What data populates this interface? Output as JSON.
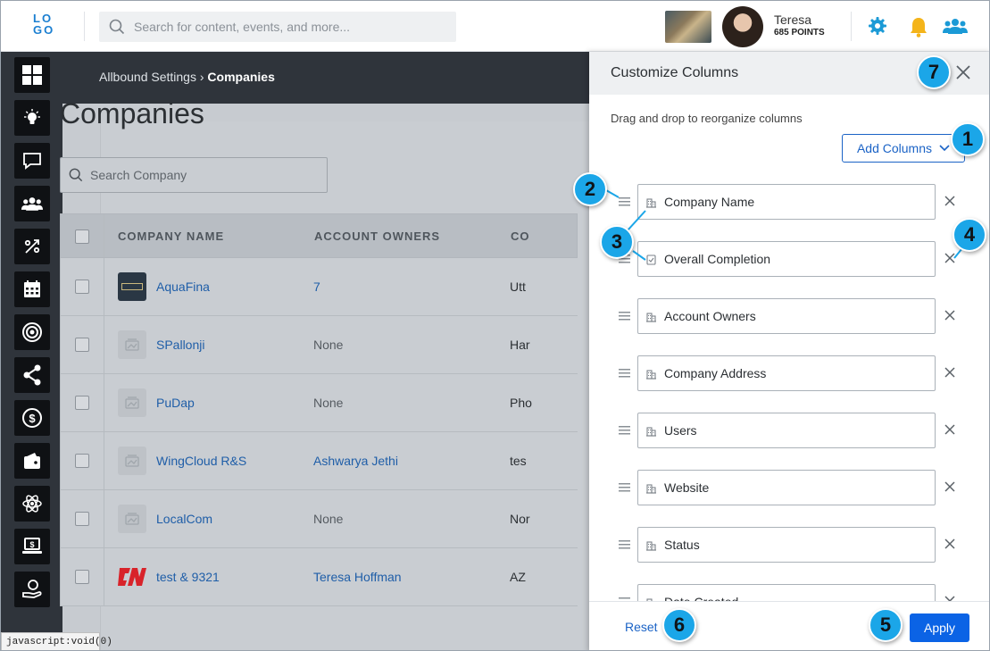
{
  "topbar": {
    "logo_top": "LO",
    "logo_bottom": "GO",
    "search_placeholder": "Search for content, events, and more...",
    "user_name": "Teresa",
    "user_points": "685 POINTS"
  },
  "breadcrumb": {
    "parent": "Allbound Settings",
    "separator": " › ",
    "current": "Companies"
  },
  "page": {
    "title": "Companies",
    "search_placeholder": "Search Company"
  },
  "table": {
    "headers": [
      "COMPANY NAME",
      "ACCOUNT OWNERS",
      "CO"
    ],
    "rows": [
      {
        "name": "AquaFina",
        "owner": "7",
        "col3": "Utt",
        "owner_link": true,
        "logo": "dark"
      },
      {
        "name": "SPallonji",
        "owner": "None",
        "col3": "Har",
        "owner_link": false,
        "logo": "placeholder"
      },
      {
        "name": "PuDap",
        "owner": "None",
        "col3": "Pho",
        "owner_link": false,
        "logo": "placeholder"
      },
      {
        "name": "WingCloud R&S",
        "owner": "Ashwarya Jethi",
        "col3": "tes",
        "owner_link": true,
        "logo": "placeholder"
      },
      {
        "name": "LocalCom",
        "owner": "None",
        "col3": "Nor",
        "owner_link": false,
        "logo": "placeholder"
      },
      {
        "name": "test & 9321",
        "owner": "Teresa Hoffman",
        "col3": "AZ",
        "owner_link": true,
        "logo": "red"
      }
    ]
  },
  "panel": {
    "title": "Customize Columns",
    "hint": "Drag and drop to reorganize columns",
    "add_columns_label": "Add Columns",
    "columns": [
      {
        "label": "Company Name",
        "icon": "building-icon"
      },
      {
        "label": "Overall Completion",
        "icon": "checklist-icon"
      },
      {
        "label": "Account Owners",
        "icon": "building-icon"
      },
      {
        "label": "Company Address",
        "icon": "building-icon"
      },
      {
        "label": "Users",
        "icon": "building-icon"
      },
      {
        "label": "Website",
        "icon": "building-icon"
      },
      {
        "label": "Status",
        "icon": "building-icon"
      },
      {
        "label": "Date Created",
        "icon": "building-icon"
      }
    ],
    "reset_label": "Reset",
    "apply_label": "Apply"
  },
  "callouts": [
    "1",
    "2",
    "3",
    "4",
    "5",
    "6",
    "7"
  ],
  "status_bar": "javascript:void(0)",
  "colors": {
    "accent": "#0b63e5",
    "link": "#1f5ea8",
    "callout": "#1ba6e8",
    "sidebar": "#2f343b"
  }
}
